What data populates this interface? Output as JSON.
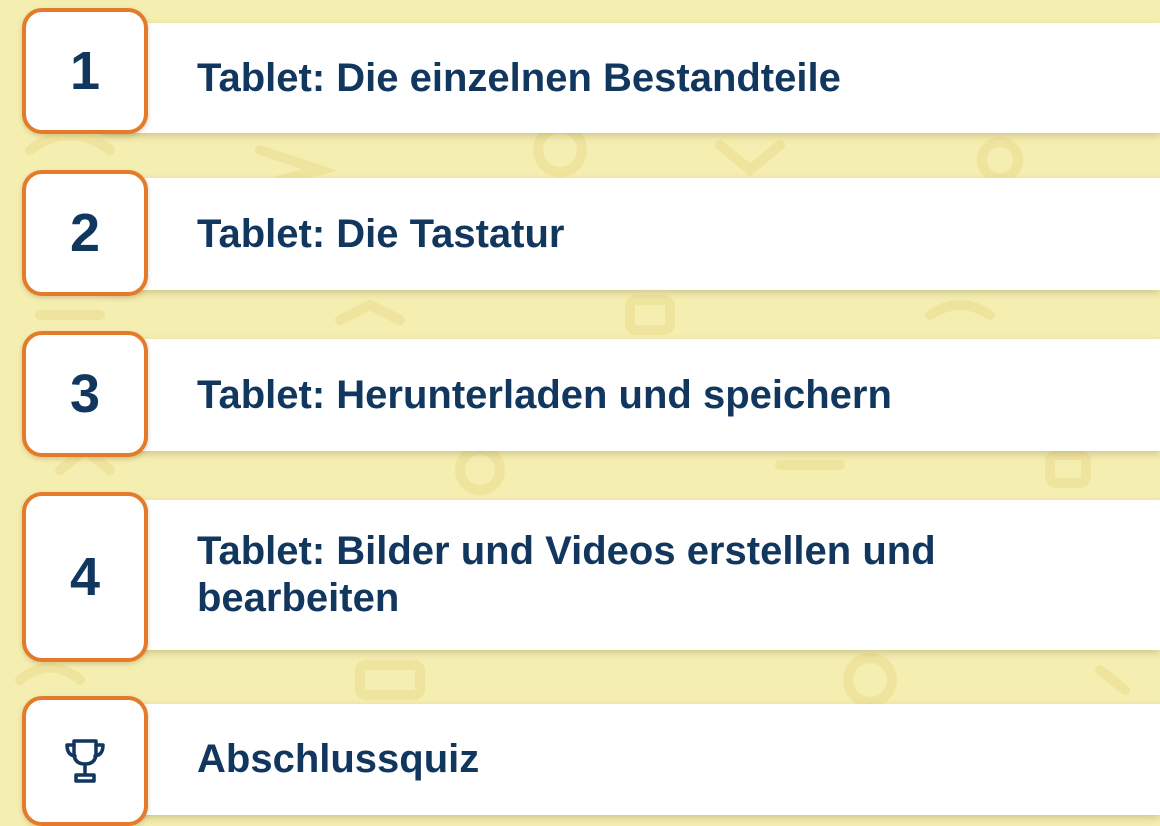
{
  "lessons": [
    {
      "number": "1",
      "title": "Tablet: Die einzelnen Bestandteile"
    },
    {
      "number": "2",
      "title": "Tablet: Die Tastatur"
    },
    {
      "number": "3",
      "title": "Tablet: Herunterladen und speichern"
    },
    {
      "number": "4",
      "title_line1": "Tablet: Bilder und Videos erstellen und",
      "title_line2": "bearbeiten"
    }
  ],
  "final_quiz": {
    "title": "Abschlussquiz",
    "icon": "trophy-icon"
  },
  "colors": {
    "background": "#f5eeb1",
    "badge_border": "#e37b2a",
    "text": "#12375e",
    "card": "#ffffff"
  }
}
